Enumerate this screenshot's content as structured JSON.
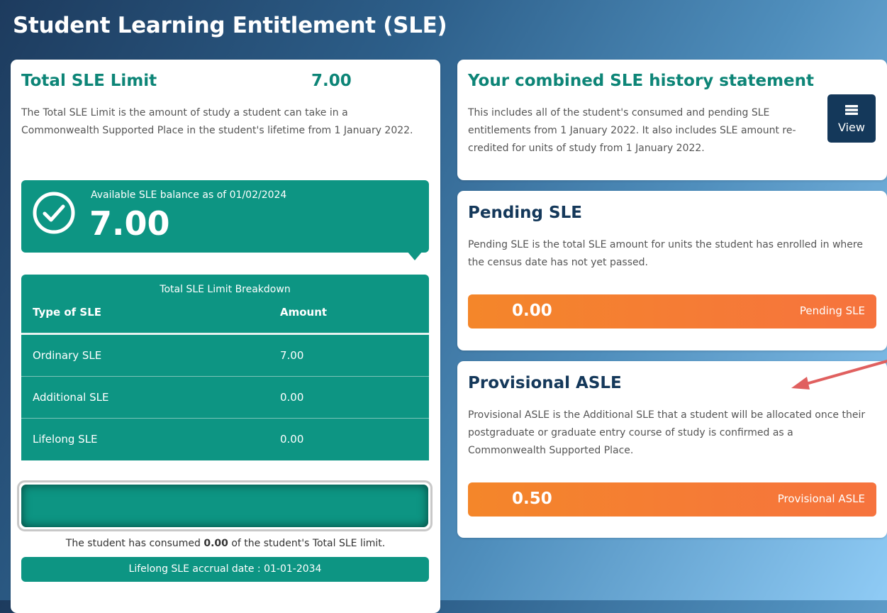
{
  "page": {
    "title": "Student Learning Entitlement (SLE)"
  },
  "total_sle": {
    "title": "Total SLE Limit",
    "value": "7.00",
    "description": "The Total SLE Limit is the amount of study a student can take in a Commonwealth Supported Place in the student's lifetime from 1 January 2022.",
    "balance_label": "Available SLE balance as of 01/02/2024",
    "balance_value": "7.00",
    "icon": "check-circle-icon"
  },
  "breakdown": {
    "title": "Total SLE Limit Breakdown",
    "col_type": "Type of SLE",
    "col_amount": "Amount",
    "rows": [
      {
        "type": "Ordinary SLE",
        "amount": "7.00"
      },
      {
        "type": "Additional SLE",
        "amount": "0.00"
      },
      {
        "type": "Lifelong SLE",
        "amount": "0.00"
      }
    ]
  },
  "consumption": {
    "consumed_fraction": 0,
    "text_before": "The student has consumed ",
    "consumed_value": "0.00",
    "text_after": " of the student's Total SLE limit.",
    "accrual_date": "Lifelong SLE accrual date : 01-01-2034"
  },
  "history": {
    "title": "Your combined SLE history statement",
    "description": "This includes all of the student's consumed and pending SLE entitlements from 1 January 2022. It also includes SLE amount re-credited for units of study from 1 January 2022.",
    "button_label": "View",
    "button_icon": "list-icon"
  },
  "pending": {
    "title": "Pending SLE",
    "description": "Pending SLE is the total SLE amount for units the student has enrolled in where the census date has not yet passed.",
    "value": "0.00",
    "label": "Pending SLE"
  },
  "provisional": {
    "title": "Provisional ASLE",
    "description": "Provisional ASLE is the Additional SLE that a student will be allocated once their postgraduate or graduate entry course of study is confirmed as a Commonwealth Supported Place.",
    "value": "0.50",
    "label": "Provisional ASLE"
  },
  "colors": {
    "teal": "#0d9583",
    "navy": "#14385a",
    "orange": "#f4862a",
    "annotation_arrow": "#e0605f"
  }
}
